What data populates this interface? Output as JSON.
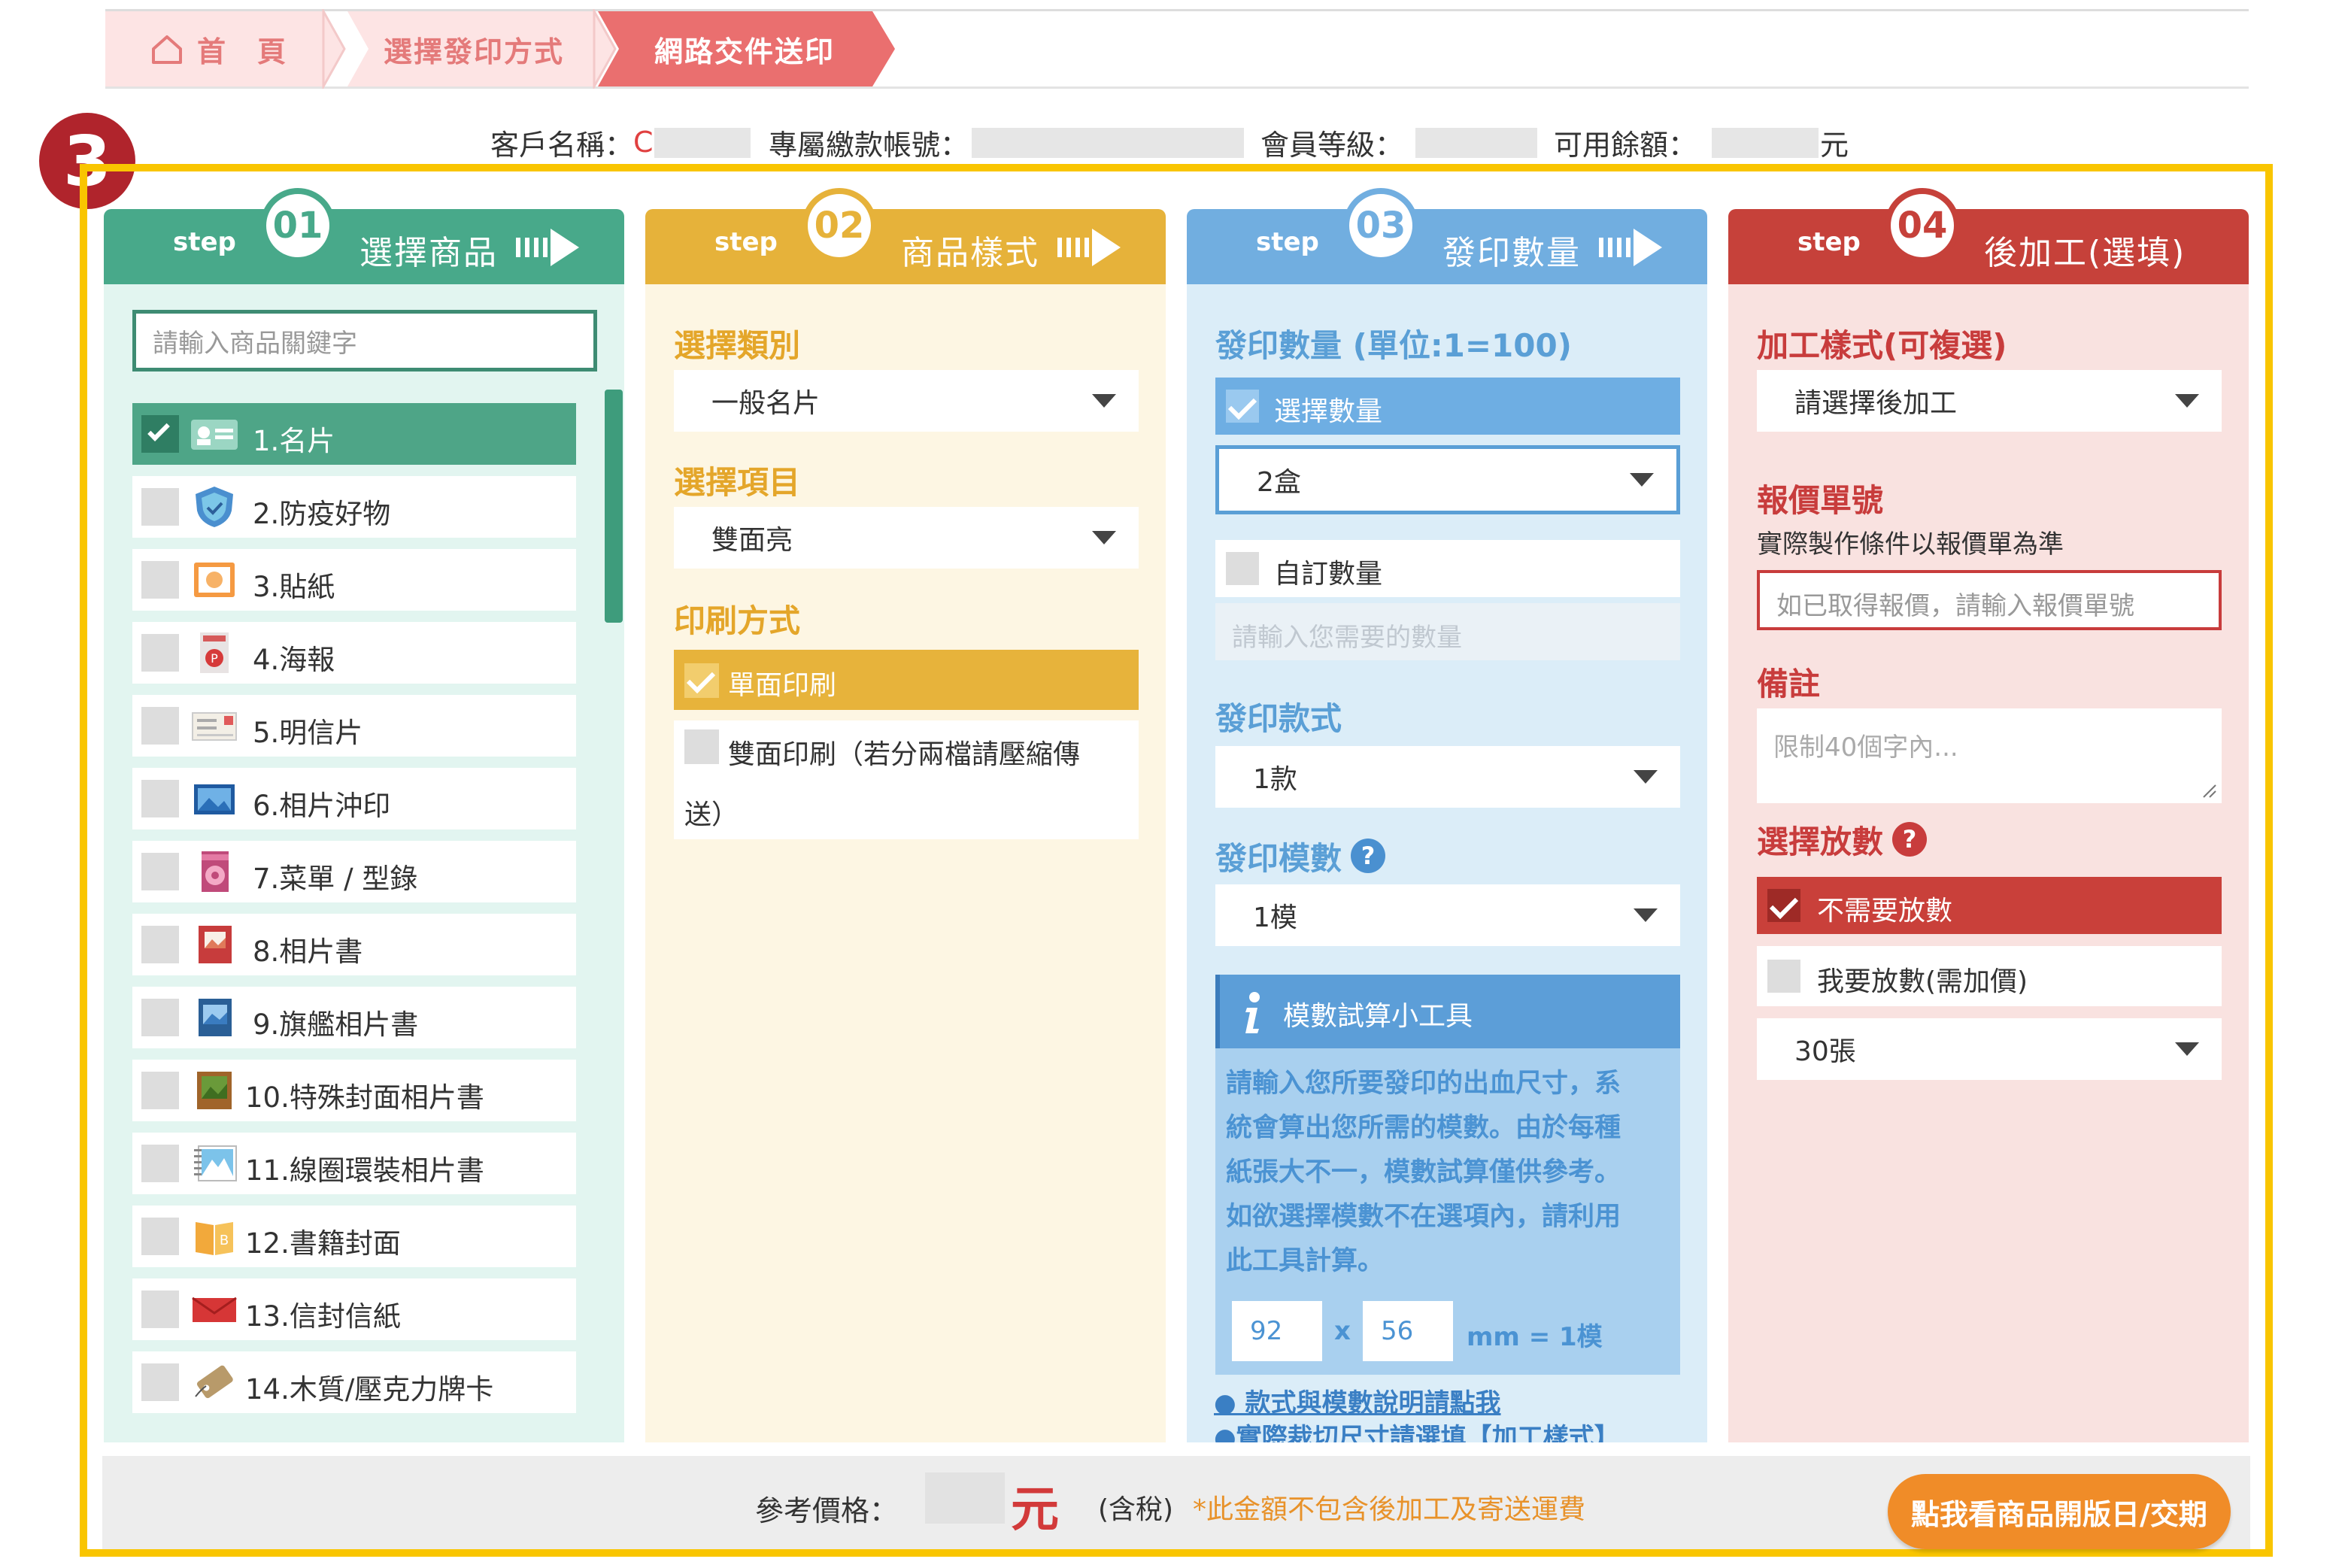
{
  "breadcrumb": {
    "home": "首　頁",
    "step2": "選擇發印方式",
    "step3": "網路交件送印"
  },
  "info": {
    "customer_label": "客戶名稱：",
    "customer_value": "C",
    "account_label": "專屬繳款帳號：",
    "level_label": "會員等級：",
    "balance_label": "可用餘額：",
    "balance_unit": "元"
  },
  "badge": "3",
  "columns": {
    "c1": {
      "step": "step",
      "num": "01",
      "title": "選擇商品",
      "color": "#48a98a"
    },
    "c2": {
      "step": "step",
      "num": "02",
      "title": "商品樣式",
      "color": "#e6b23a"
    },
    "c3": {
      "step": "step",
      "num": "03",
      "title": "發印數量",
      "color": "#71aee0"
    },
    "c4": {
      "step": "step",
      "num": "04",
      "title": "後加工(選填)",
      "color": "#c6413a"
    }
  },
  "products": {
    "search_placeholder": "請輸入商品關鍵字",
    "items": [
      {
        "label": "1.名片",
        "icon": "business-card-icon",
        "selected": true
      },
      {
        "label": "2.防疫好物",
        "icon": "shield-icon"
      },
      {
        "label": "3.貼紙",
        "icon": "sticker-icon"
      },
      {
        "label": "4.海報",
        "icon": "poster-icon"
      },
      {
        "label": "5.明信片",
        "icon": "postcard-icon"
      },
      {
        "label": "6.相片沖印",
        "icon": "photo-icon"
      },
      {
        "label": "7.菜單 / 型錄",
        "icon": "menu-icon"
      },
      {
        "label": "8.相片書",
        "icon": "photo-book-icon"
      },
      {
        "label": "9.旗艦相片書",
        "icon": "premium-photo-book-icon"
      },
      {
        "label": "10.特殊封面相片書",
        "icon": "special-cover-book-icon"
      },
      {
        "label": "11.線圈環裝相片書",
        "icon": "spiral-book-icon"
      },
      {
        "label": "12.書籍封面",
        "icon": "book-cover-icon"
      },
      {
        "label": "13.信封信紙",
        "icon": "envelope-icon"
      },
      {
        "label": "14.木質/壓克力牌卡",
        "icon": "wood-tag-icon"
      }
    ]
  },
  "style": {
    "category_heading": "選擇類別",
    "category_value": "一般名片",
    "item_heading": "選擇項目",
    "item_value": "雙面亮",
    "print_heading": "印刷方式",
    "print_single": "單面印刷",
    "print_double_1": "雙面印刷（若分兩檔請壓縮傳",
    "print_double_2": "送）"
  },
  "quantity": {
    "heading": "發印數量 (單位:1=100)",
    "select_qty": "選擇數量",
    "qty_value": "2盒",
    "custom_qty": "自訂數量",
    "custom_placeholder": "請輸入您需要的數量",
    "style_heading": "發印款式",
    "style_value": "1款",
    "mold_heading": "發印模數",
    "mold_help": "?",
    "mold_value": "1模",
    "tool_title": "模數試算小工具",
    "tool_text": [
      "請輸入您所要發印的出血尺寸，系",
      "統會算出您所需的模數。由於每種",
      "紙張大不一，模數試算僅供參考。",
      "如欲選擇模數不在選項內，請利用",
      "此工具計算。"
    ],
    "w_value": "92",
    "times": "x",
    "h_value": "56",
    "result": "mm = 1模",
    "link1": "● 款式與模數說明請點我",
    "link2": "●實際裁切尺寸請選填【加工樣式】"
  },
  "post": {
    "heading": "加工樣式(可複選)",
    "finish_value": "請選擇後加工",
    "quote_heading": "報價單號",
    "quote_sub": "實際製作條件以報價單為準",
    "quote_placeholder": "如已取得報價，請輸入報價單號",
    "note_heading": "備註",
    "note_placeholder": "限制40個字內...",
    "place_heading": "選擇放數",
    "place_help": "?",
    "no_place": "不需要放數",
    "want_place": "我要放數(需加價)",
    "sheets_value": "30張"
  },
  "footer": {
    "price_label": "參考價格：",
    "price_unit": "元",
    "tax": "(含稅)",
    "note": "*此金額不包含後加工及寄送運費",
    "button": "點我看商品開版日/交期"
  }
}
